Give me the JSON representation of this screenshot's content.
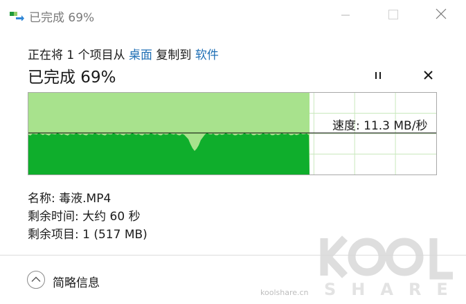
{
  "window": {
    "title": "已完成 69%",
    "app_icon": "file-copy-icon",
    "controls": {
      "minimize_icon": "minimize-icon",
      "maximize_icon": "maximize-icon",
      "close_icon": "close-icon"
    }
  },
  "copy_info": {
    "prefix": "正在将 1 个项目从 ",
    "source": "桌面",
    "middle": " 复制到 ",
    "destination": "软件"
  },
  "progress": {
    "title": "已完成 69%",
    "percent": 69,
    "pause_icon": "pause-icon",
    "cancel_icon": "cancel-icon"
  },
  "graph": {
    "speed_label": "速度: 11.3 MB/秒",
    "fill_fraction": 0.69,
    "colors": {
      "background_fill": "#a8e28d",
      "speed_fill": "#0fae2c",
      "grid": "#c9e8bd",
      "line": "#000000"
    }
  },
  "details": {
    "name": "名称: 毒液.MP4",
    "time_remaining": "剩余时间: 大约 60 秒",
    "items_remaining": "剩余项目: 1 (517 MB)"
  },
  "footer": {
    "less_details_label": "简略信息",
    "less_details_icon": "chevron-up-icon"
  },
  "watermark": {
    "logo_text": "KOOL",
    "logo_subtext": "SHARE",
    "site": "koolshare.cn"
  }
}
